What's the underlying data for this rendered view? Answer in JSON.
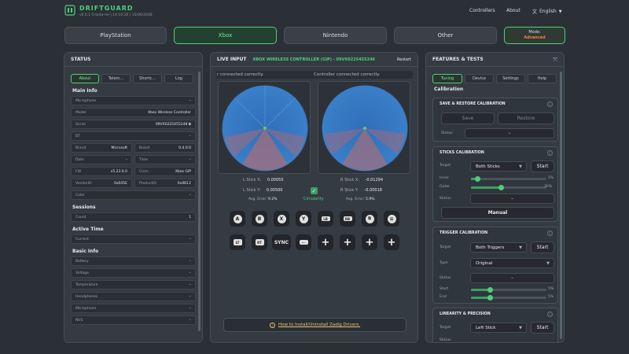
{
  "app": {
    "brand": "DRIFTGUARD",
    "version": "v0.5.1-5-beta-rel | 14:10:26 | 15/06/2026",
    "nav": {
      "controllers": "Controllers",
      "about": "About",
      "language": "English"
    }
  },
  "platforms": [
    {
      "label": "PlayStation",
      "active": false
    },
    {
      "label": "Xbox",
      "active": true
    },
    {
      "label": "Nintendo",
      "active": false
    },
    {
      "label": "Other",
      "active": false
    }
  ],
  "mode": {
    "label": "Mode:",
    "value": "Advanced"
  },
  "status": {
    "title": "STATUS",
    "tabs": [
      "About",
      "Telem...",
      "Shortc...",
      "Log"
    ],
    "main_info_title": "Main Info",
    "fields": {
      "microphone": {
        "label": "Microphone",
        "value": "–"
      },
      "model": {
        "label": "Model",
        "value": "Xbox Wireless Controller"
      },
      "serial": {
        "label": "Serial",
        "value": "09VX0225455248"
      },
      "bt": {
        "label": "BT",
        "value": "–"
      },
      "brand": {
        "label": "Brand",
        "value": "Microsoft"
      },
      "board": {
        "label": "Board",
        "value": "0.4.0.0"
      },
      "date": {
        "label": "Date",
        "value": "–"
      },
      "time": {
        "label": "Time",
        "value": "–"
      },
      "fw": {
        "label": "FW",
        "value": "v5.23.6.0"
      },
      "conn": {
        "label": "Conn.",
        "value": "Xbox GIP"
      },
      "vendorid": {
        "label": "VendorID",
        "value": "0x045E"
      },
      "productid": {
        "label": "ProductID",
        "value": "0x0B12"
      },
      "color": {
        "label": "Color",
        "value": "–"
      }
    },
    "sessions_title": "Sessions",
    "sessions_count": {
      "label": "Count",
      "value": "1"
    },
    "active_time_title": "Active Time",
    "active_time_current": {
      "label": "Current",
      "value": "–"
    },
    "basic_info_title": "Basic Info",
    "basic": [
      {
        "label": "Battery",
        "value": "–"
      },
      {
        "label": "Voltage",
        "value": "–"
      },
      {
        "label": "Temperature",
        "value": "–"
      },
      {
        "label": "Headphones",
        "value": "–"
      },
      {
        "label": "Microphone",
        "value": "–"
      },
      {
        "label": "NVS",
        "value": "–"
      }
    ]
  },
  "live": {
    "title": "LIVE INPUT",
    "device": "XBOX WIRELESS CONTROLLER (GIP) - 09VX0225455246",
    "restart": "Restart",
    "status_left": "r connected correctly.",
    "status_right": "Controller connected correctly.",
    "left": {
      "x_label": "L Stick X:",
      "x_value": "0.00055",
      "y_label": "L Stick Y:",
      "y_value": "0.00500",
      "err_label": "Avg. Error:",
      "err_value": "9.2%"
    },
    "right": {
      "x_label": "R Stick X:",
      "x_value": "-0.01294",
      "y_label": "R Stick Y:",
      "y_value": "-0.00018",
      "err_label": "Avg. Error:",
      "err_value": "5.9%"
    },
    "circularity": "Circularity",
    "circularity_checked": true,
    "buttons_row1": [
      "A",
      "B",
      "X",
      "Y",
      "LB",
      "RB",
      "⧉",
      "≡"
    ],
    "buttons_row2": [
      "LT",
      "RT",
      "SYNC",
      "⋯",
      "+",
      "+",
      "+",
      "+"
    ],
    "help_link": "How to Install/Uninstall Zadig Drivers."
  },
  "features": {
    "title": "FEATURES & TESTS",
    "tabs": [
      "Tuning",
      "Device",
      "Settings",
      "Help"
    ],
    "section": "Calibration",
    "save_restore": {
      "title": "SAVE & RESTORE CALIBRATION",
      "save": "Save",
      "restore": "Restore",
      "status_label": "Status",
      "status_value": "–"
    },
    "sticks": {
      "title": "STICKS CALIBRATION",
      "target_label": "Target",
      "target_value": "Both Sticks",
      "start": "Start",
      "inner_label": "Inner",
      "inner_value": "5%",
      "outer_label": "Outer",
      "outer_value": "30%",
      "status_label": "Status",
      "status_value": "–",
      "manual": "Manual"
    },
    "triggers": {
      "title": "TRIGGER CALIBRATION",
      "target_label": "Target",
      "target_value": "Both Triggers",
      "start": "Start",
      "type_label": "Type",
      "type_value": "Original",
      "status_label": "Status",
      "status_value": "–",
      "start_label": "Start",
      "start_value": "5%",
      "end_label": "End",
      "end_value": "5%"
    },
    "linearity": {
      "title": "LINEARITY & PRECISION",
      "target_label": "Target",
      "target_value": "Left Stick",
      "start": "Start",
      "status_label": "Status"
    }
  },
  "colors": {
    "accent": "#4fcf7a",
    "panel": "#353b43",
    "background": "#2b3037",
    "mode_value": "#ff7a45"
  }
}
